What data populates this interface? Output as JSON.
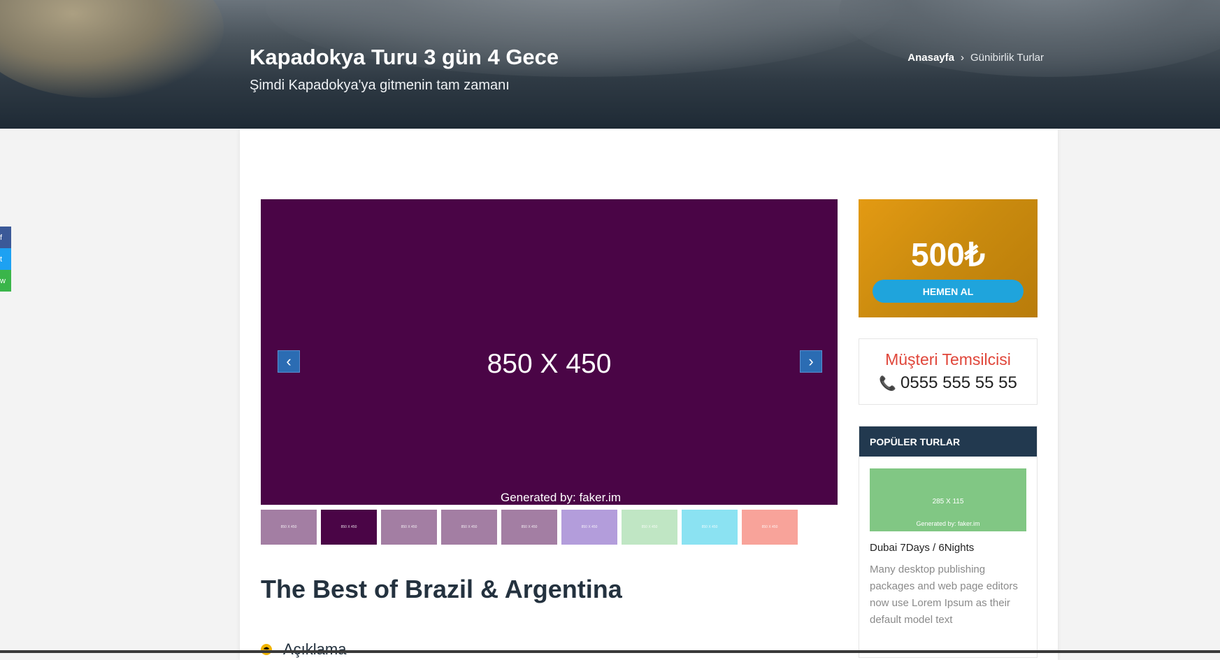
{
  "hero": {
    "title": "Kapadokya Turu 3 gün 4 Gece",
    "subtitle": "Şimdi Kapadokya'ya gitmenin tam zamanı"
  },
  "breadcrumb": {
    "home": "Anasayfa",
    "separator": "›",
    "current": "Günibirlik Turlar"
  },
  "slider": {
    "label": "850 X 450",
    "credit": "Generated by: faker.im",
    "prev_icon": "‹",
    "next_icon": "›",
    "background": "#4a0546",
    "thumbnails": [
      {
        "label": "850 X 450",
        "color": "#a37ea3"
      },
      {
        "label": "850 X 450",
        "color": "#4a0546"
      },
      {
        "label": "850 X 450",
        "color": "#a37ea3"
      },
      {
        "label": "850 X 450",
        "color": "#a37ea3"
      },
      {
        "label": "850 X 450",
        "color": "#a37ea3"
      },
      {
        "label": "850 X 450",
        "color": "#b39ddb"
      },
      {
        "label": "850 X 450",
        "color": "#c0e6c4"
      },
      {
        "label": "850 X 450",
        "color": "#8be2f2"
      },
      {
        "label": "850 X 450",
        "color": "#f8a39a"
      }
    ]
  },
  "content": {
    "title": "The Best of Brazil & Argentina",
    "section_label": "Açıklama"
  },
  "promo": {
    "price": "500₺",
    "button": "HEMEN AL"
  },
  "representative": {
    "title": "Müşteri Temsilcisi",
    "phone": "0555 555 55 55"
  },
  "popular": {
    "heading": "POPÜLER TURLAR",
    "image_label": "285 X 115",
    "image_credit": "Generated by: faker.im",
    "name": "Dubai 7Days / 6Nights",
    "description": "Many desktop publishing packages and web page editors now use Lorem Ipsum as their default model text"
  },
  "share": {
    "facebook_icon": "f",
    "twitter_icon": "t",
    "whatsapp_icon": "w"
  },
  "colors": {
    "accent_blue": "#1fa4dc",
    "rep_title": "#e0463a",
    "popular_header": "#22394f"
  }
}
